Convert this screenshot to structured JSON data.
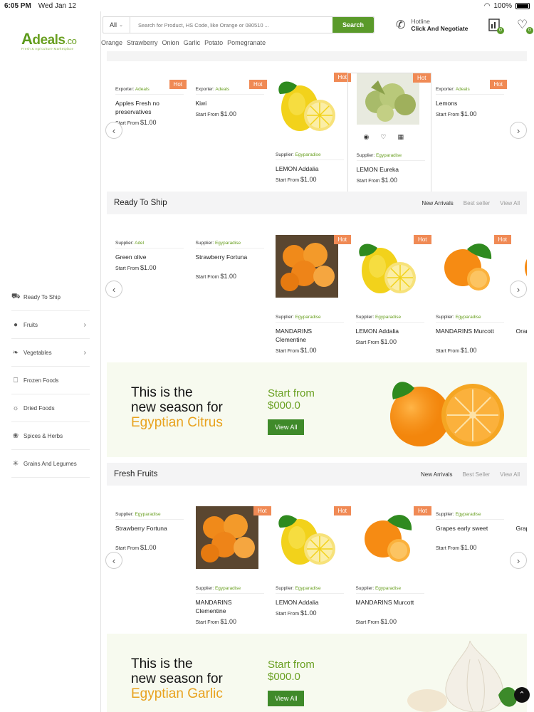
{
  "status": {
    "time": "6:05 PM",
    "date": "Wed Jan 12",
    "battery": "100%"
  },
  "logo": {
    "word_a": "A",
    "word_rest": "deals",
    "word_co": ".co",
    "tagline": "Fresh & Agriculture Marketplace"
  },
  "header": {
    "search_category": "All",
    "search_placeholder": "Search for Product, HS Code, like Orange or 080510 ...",
    "search_button": "Search",
    "hotline_label": "Hotline",
    "hotline_action": "Click And Negotiate",
    "compare_count": "0",
    "wishlist_count": "0"
  },
  "quick_links": [
    "Orange",
    "Strawberry",
    "Onion",
    "Garlic",
    "Potato",
    "Pomegranate"
  ],
  "sidebar": {
    "categories": [
      {
        "label": "Ready To Ship",
        "icon": "truck-icon",
        "has_sub": false
      },
      {
        "label": "Fruits",
        "icon": "apple-icon",
        "has_sub": true
      },
      {
        "label": "Vegetables",
        "icon": "wheat-icon",
        "has_sub": true
      },
      {
        "label": "Frozen Foods",
        "icon": "bag-icon",
        "has_sub": false
      },
      {
        "label": "Dried Foods",
        "icon": "sun-icon",
        "has_sub": false
      },
      {
        "label": "Spices & Herbs",
        "icon": "spice-icon",
        "has_sub": false
      },
      {
        "label": "Grains And Legumes",
        "icon": "grain-icon",
        "has_sub": false
      }
    ]
  },
  "common": {
    "hot": "Hot",
    "start_from": "Start From",
    "supplier": "Supplier:",
    "exporter": "Exporter:"
  },
  "top_row": [
    {
      "role": "Exporter:",
      "company": "Adeals",
      "name": "Apples Fresh no preservatives",
      "price": "$1.00",
      "image": "",
      "hot": true
    },
    {
      "role": "Exporter:",
      "company": "Adeals",
      "name": "Kiwi",
      "price": "$1.00",
      "image": "",
      "hot": true
    },
    {
      "role": "Supplier:",
      "company": "Egyparadise",
      "name": "LEMON Addalia",
      "price": "$1.00",
      "image": "lemon",
      "hot": true
    },
    {
      "role": "Supplier:",
      "company": "Egyparadise",
      "name": "LEMON Eureka",
      "price": "$1.00",
      "image": "lemon-eureka",
      "hot": true
    },
    {
      "role": "Exporter:",
      "company": "Adeals",
      "name": "Lemons",
      "price": "$1.00",
      "image": "",
      "hot": true
    }
  ],
  "ready_to_ship": {
    "title": "Ready To Ship",
    "tabs": [
      "New Arrivals",
      "Best seller",
      "View All"
    ],
    "items": [
      {
        "company": "Adel",
        "name": "Green olive",
        "price": "$1.00",
        "image": ""
      },
      {
        "company": "Egyparadise",
        "name": "Strawberry Fortuna",
        "price": "$1.00",
        "image": ""
      },
      {
        "company": "Egyparadise",
        "name": "MANDARINS Clementine",
        "price": "$1.00",
        "image": "mandarin"
      },
      {
        "company": "Egyparadise",
        "name": "LEMON Addalia",
        "price": "$1.00",
        "image": "lemon"
      },
      {
        "company": "Egyparadise",
        "name": "MANDARINS Murcott",
        "price": "$1.00",
        "image": "orange"
      },
      {
        "company": "",
        "name": "Oran",
        "price": "",
        "image": "orange"
      }
    ]
  },
  "banner_citrus": {
    "line1": "This is the",
    "line2": "new season for",
    "accent": "Egyptian Citrus",
    "from_label": "Start from",
    "price": "$000.0",
    "button": "View All"
  },
  "fresh_fruits": {
    "title": "Fresh Fruits",
    "tabs": [
      "New Arrivals",
      "Best Seller",
      "View All"
    ],
    "items": [
      {
        "company": "Egyparadise",
        "name": "Strawberry Fortuna",
        "price": "$1.00",
        "image": ""
      },
      {
        "company": "Egyparadise",
        "name": "MANDARINS Clementine",
        "price": "$1.00",
        "image": "mandarin"
      },
      {
        "company": "Egyparadise",
        "name": "LEMON Addalia",
        "price": "$1.00",
        "image": "lemon"
      },
      {
        "company": "Egyparadise",
        "name": "MANDARINS Murcott",
        "price": "$1.00",
        "image": "orange"
      },
      {
        "company": "Egyparadise",
        "name": "Grapes early sweet",
        "price": "$1.00",
        "image": ""
      },
      {
        "company": "",
        "name": "Grap",
        "price": "",
        "image": ""
      }
    ]
  },
  "banner_garlic": {
    "line1": "This is the",
    "line2": "new season for",
    "accent": "Egyptian Garlic",
    "from_label": "Start from",
    "price": "$000.0",
    "button": "View All"
  },
  "colors": {
    "brand_green": "#5a9a2a",
    "hot_orange": "#f08a55",
    "accent_gold": "#e8a21e"
  }
}
